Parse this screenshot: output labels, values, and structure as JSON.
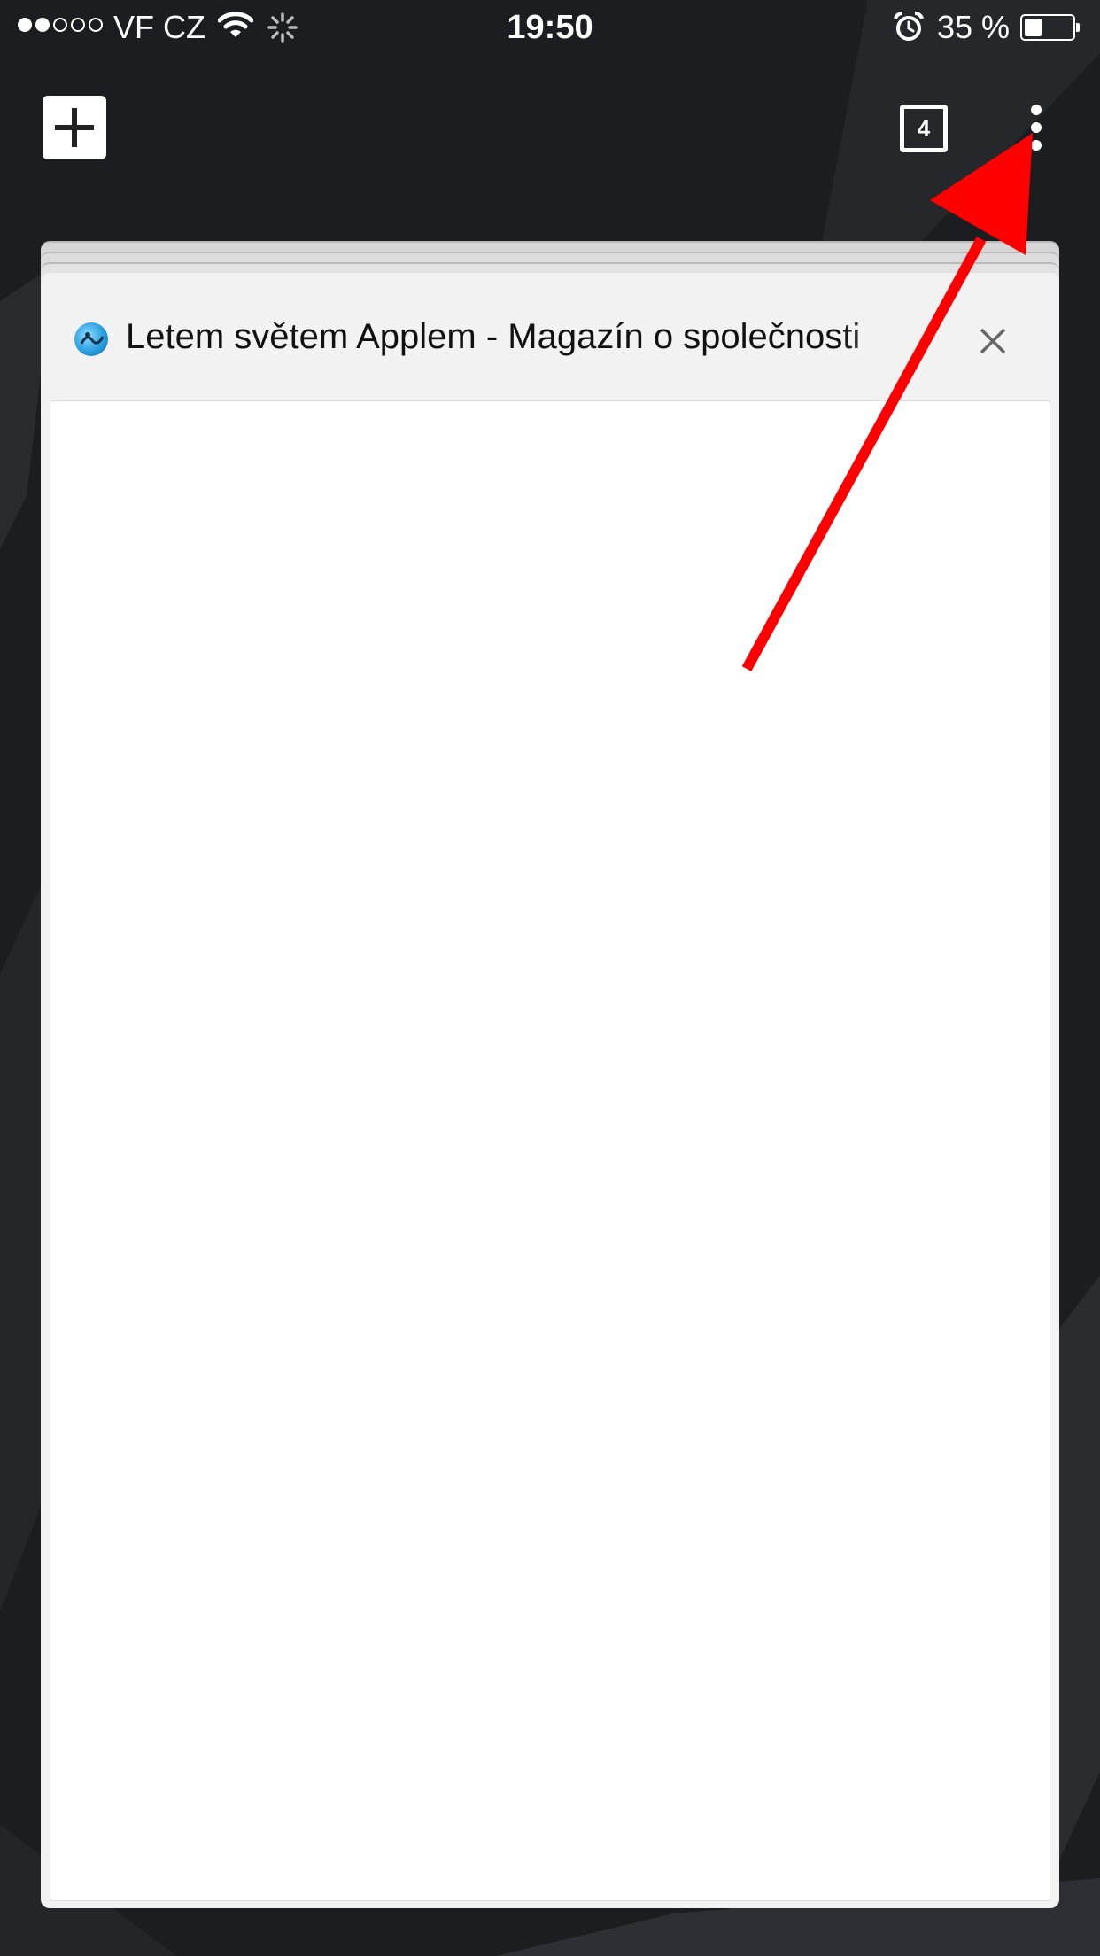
{
  "status_bar": {
    "carrier": "VF CZ",
    "signal_bars_filled": 2,
    "signal_bars_total": 5,
    "time": "19:50",
    "battery": "35 %",
    "battery_level": 0.35,
    "icons": [
      "wifi-icon",
      "activity-icon",
      "alarm-icon",
      "battery-icon"
    ]
  },
  "toolbar": {
    "new_tab_icon": "plus-icon",
    "tab_count": "4",
    "menu_icon": "more-vertical-icon"
  },
  "tab": {
    "title": "Letem světem Applem - Magazín o společnosti",
    "favicon": "site-favicon",
    "close_icon": "close-icon"
  },
  "annotation": {
    "type": "arrow",
    "color": "#ff0000",
    "points_to": "menu-button"
  }
}
